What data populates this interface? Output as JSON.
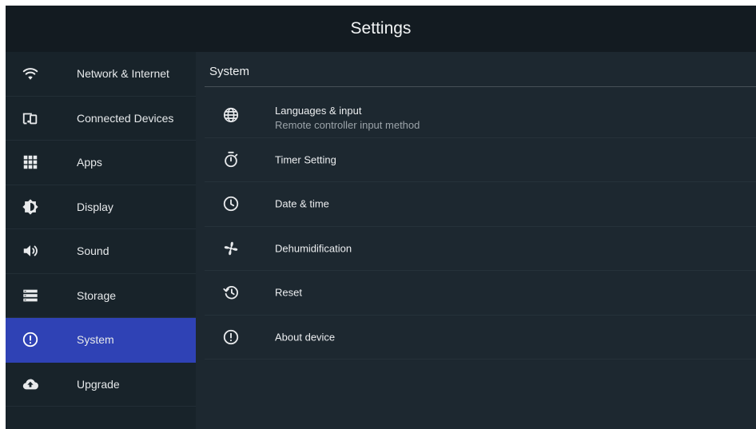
{
  "header": {
    "title": "Settings"
  },
  "sidebar": {
    "items": [
      {
        "label": "Network & Internet",
        "icon": "wifi-icon",
        "active": false
      },
      {
        "label": "Connected Devices",
        "icon": "devices-icon",
        "active": false
      },
      {
        "label": "Apps",
        "icon": "apps-grid-icon",
        "active": false
      },
      {
        "label": "Display",
        "icon": "brightness-icon",
        "active": false
      },
      {
        "label": "Sound",
        "icon": "speaker-icon",
        "active": false
      },
      {
        "label": "Storage",
        "icon": "storage-icon",
        "active": false
      },
      {
        "label": "System",
        "icon": "info-icon",
        "active": true
      },
      {
        "label": "Upgrade",
        "icon": "cloud-upload-icon",
        "active": false
      }
    ]
  },
  "main": {
    "section_title": "System",
    "items": [
      {
        "label": "Languages & input",
        "sublabel": "Remote controller input method",
        "icon": "globe-icon"
      },
      {
        "label": "Timer Setting",
        "icon": "timer-icon"
      },
      {
        "label": "Date & time",
        "icon": "clock-icon"
      },
      {
        "label": "Dehumidification",
        "icon": "fan-icon"
      },
      {
        "label": "Reset",
        "icon": "restore-icon"
      },
      {
        "label": "About device",
        "icon": "info-icon"
      }
    ]
  },
  "colors": {
    "background": "#1d2830",
    "header": "#131b21",
    "sidebar": "#18232a",
    "active": "#2f42b5",
    "text": "#e8eaec",
    "subtext": "#9ba3a9"
  }
}
